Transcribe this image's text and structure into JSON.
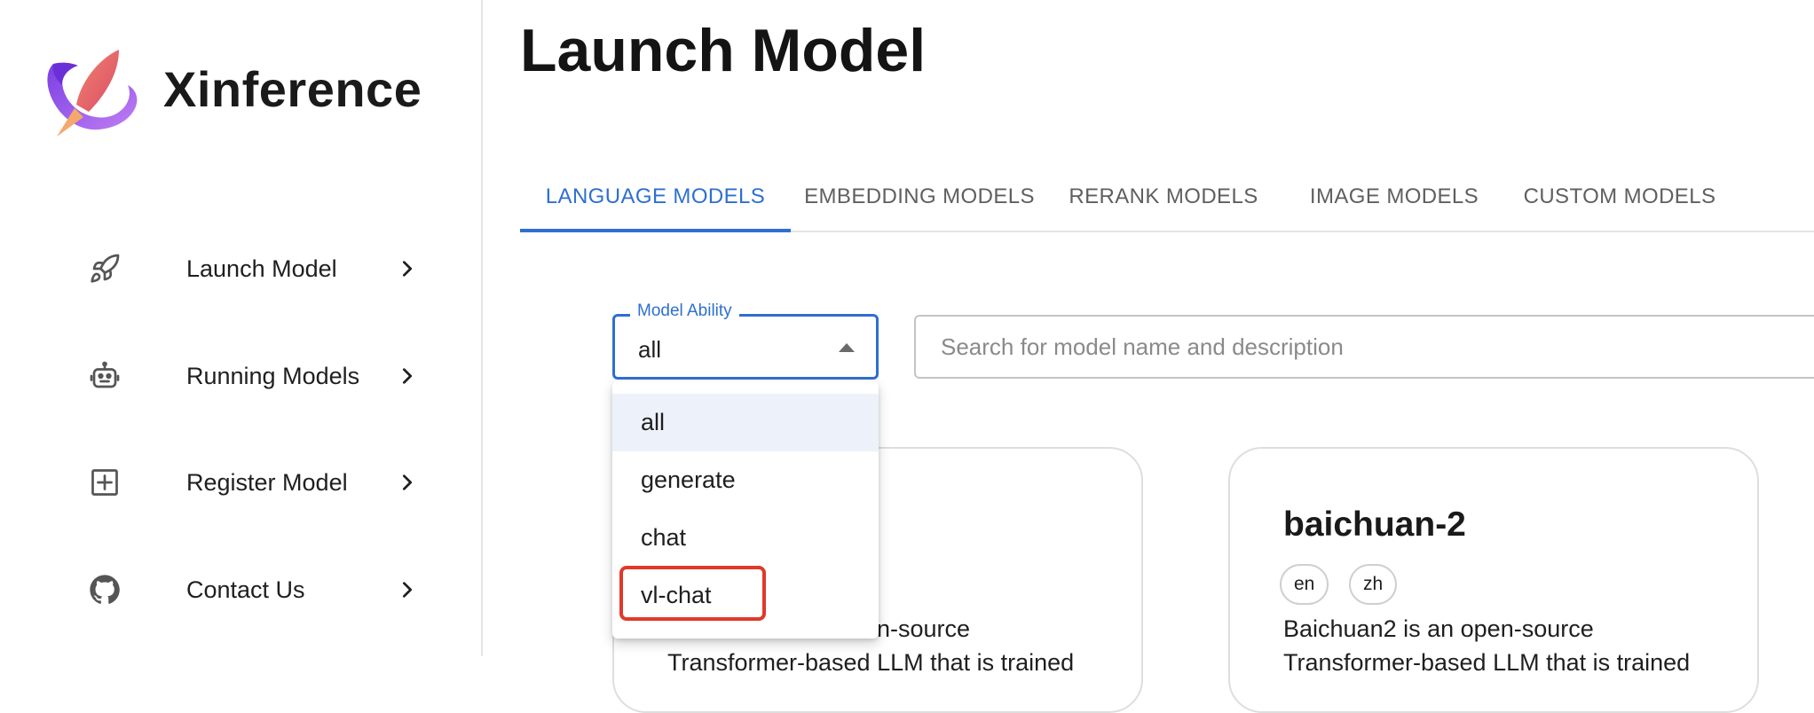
{
  "brand": {
    "name": "Xinference",
    "logo_icon": "rocket-planet-logo",
    "logo_colors": [
      "#7b3fe4",
      "#b46cf0",
      "#e8615e"
    ]
  },
  "sidebar": {
    "items": [
      {
        "label": "Launch Model",
        "icon": "rocket-icon"
      },
      {
        "label": "Running Models",
        "icon": "robot-icon"
      },
      {
        "label": "Register Model",
        "icon": "plus-square-icon"
      },
      {
        "label": "Contact Us",
        "icon": "github-icon"
      }
    ]
  },
  "page": {
    "title": "Launch Model"
  },
  "tabs": [
    {
      "label": "LANGUAGE MODELS",
      "active": true
    },
    {
      "label": "EMBEDDING MODELS",
      "active": false
    },
    {
      "label": "RERANK MODELS",
      "active": false
    },
    {
      "label": "IMAGE MODELS",
      "active": false
    },
    {
      "label": "CUSTOM MODELS",
      "active": false
    }
  ],
  "filter": {
    "label": "Model Ability",
    "value": "all",
    "options": [
      "all",
      "generate",
      "chat",
      "vl-chat"
    ],
    "highlighted_option": "vl-chat"
  },
  "search": {
    "placeholder": "Search for model name and description"
  },
  "cards": [
    {
      "title": "",
      "tags": [],
      "description_lines": [
        "n-source",
        "Transformer-based LLM that is trained"
      ]
    },
    {
      "title": "baichuan-2",
      "tags": [
        "en",
        "zh"
      ],
      "description_lines": [
        "Baichuan2 is an open-source",
        "Transformer-based LLM that is trained"
      ]
    }
  ],
  "colors": {
    "accent": "#2e6fd1",
    "highlight": "#e0392b",
    "selected_option_bg": "#edf2fa"
  }
}
